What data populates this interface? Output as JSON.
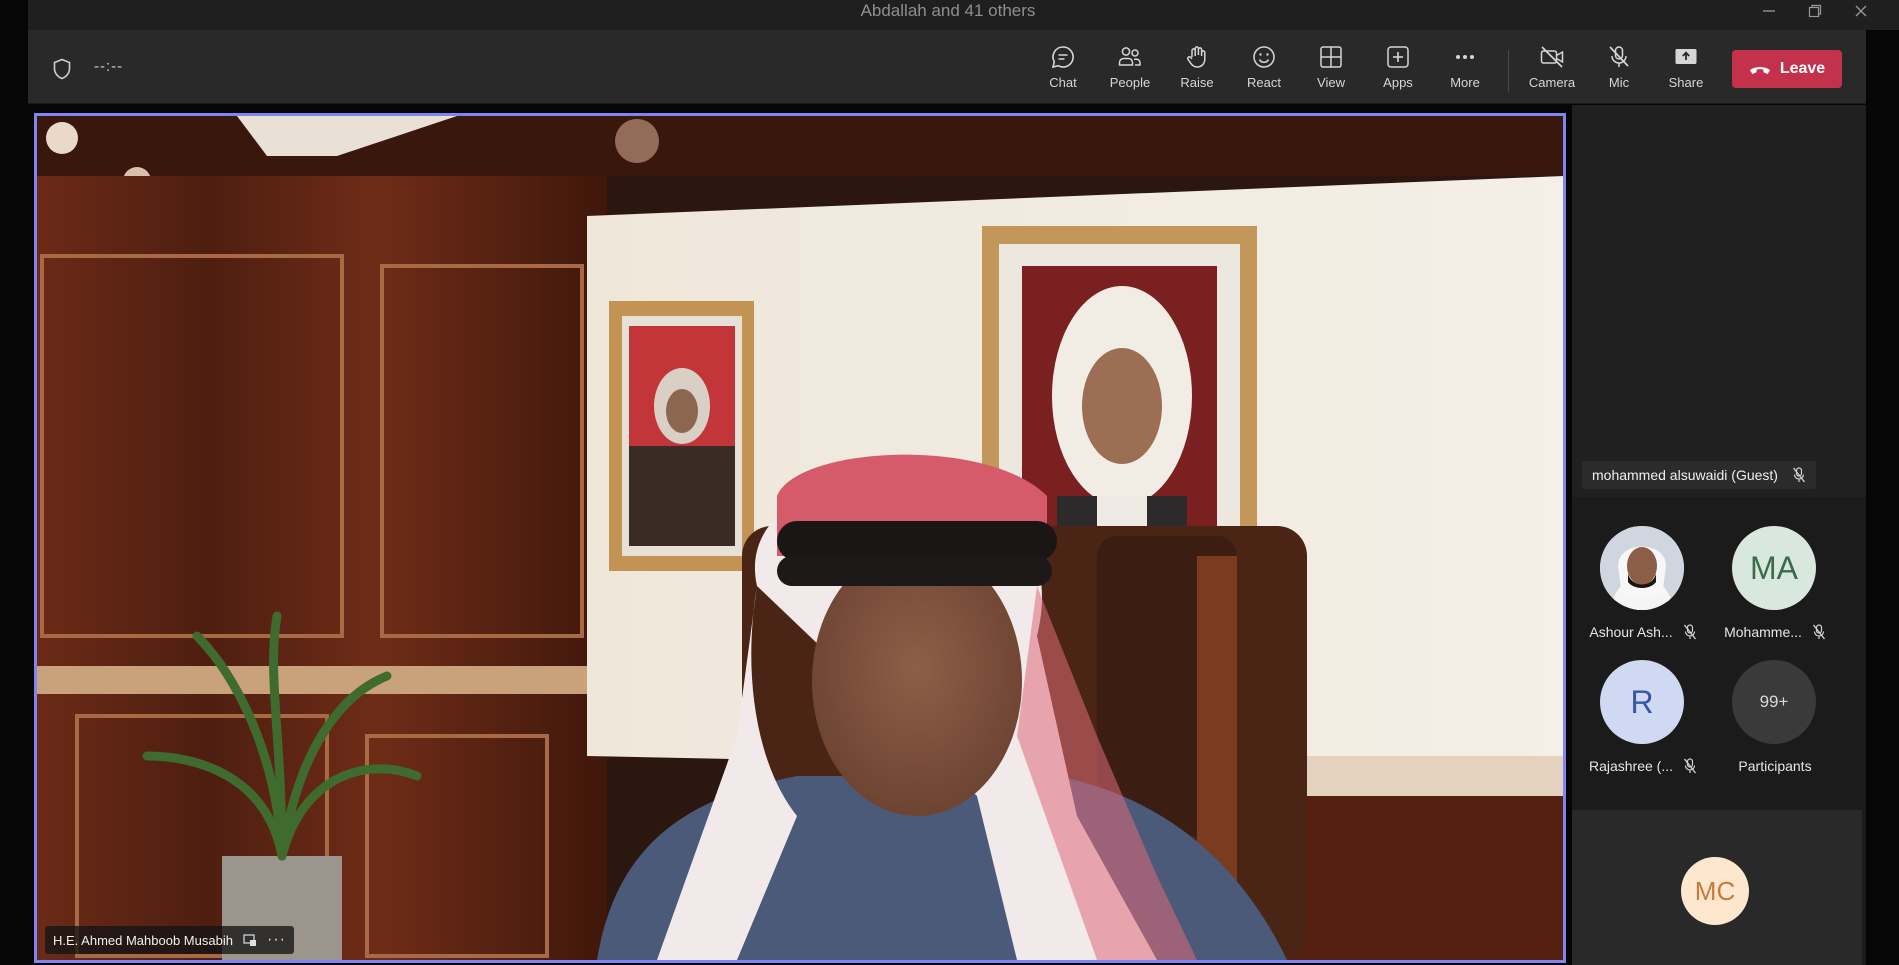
{
  "window": {
    "title": "Abdallah and 41 others"
  },
  "toolbar": {
    "timer": "--:--",
    "buttons": [
      {
        "id": "chat",
        "label": "Chat",
        "icon": "chat-icon"
      },
      {
        "id": "people",
        "label": "People",
        "icon": "people-icon"
      },
      {
        "id": "raise",
        "label": "Raise",
        "icon": "raise-hand-icon"
      },
      {
        "id": "react",
        "label": "React",
        "icon": "smiley-icon"
      },
      {
        "id": "view",
        "label": "View",
        "icon": "grid-icon"
      },
      {
        "id": "apps",
        "label": "Apps",
        "icon": "plus-square-icon"
      },
      {
        "id": "more",
        "label": "More",
        "icon": "ellipsis-icon"
      },
      {
        "id": "camera",
        "label": "Camera",
        "icon": "camera-off-icon"
      },
      {
        "id": "mic",
        "label": "Mic",
        "icon": "mic-off-icon"
      },
      {
        "id": "share",
        "label": "Share",
        "icon": "share-icon"
      }
    ],
    "leave_label": "Leave"
  },
  "stage": {
    "speaker_name": "H.E. Ahmed Mahboob Musabih",
    "highlight_color": "#7f85f5"
  },
  "side_panel": {
    "top_tile_name": "mohammed alsuwaidi (Guest)",
    "participants": [
      {
        "name": "Ashour Ash...",
        "initials": "",
        "muted": true,
        "avatar_bg": "#d9dde3"
      },
      {
        "name": "Mohamme...",
        "initials": "MA",
        "muted": true,
        "avatar_bg": "#d9e8de",
        "avatar_fg": "#3a6b4a"
      },
      {
        "name": "Rajashree (...",
        "initials": "R",
        "muted": true,
        "avatar_bg": "#cfd9f1",
        "avatar_fg": "#3656a8"
      },
      {
        "name": "Participants",
        "initials": "99+",
        "muted": false,
        "avatar_bg": "#3a3a3a",
        "avatar_fg": "#d8d8d8"
      }
    ],
    "bottom_tile_initials": "MC"
  },
  "colors": {
    "leave": "#c4314b",
    "toolbar_bg": "#292929",
    "panel_bg": "#1b1b1b"
  }
}
